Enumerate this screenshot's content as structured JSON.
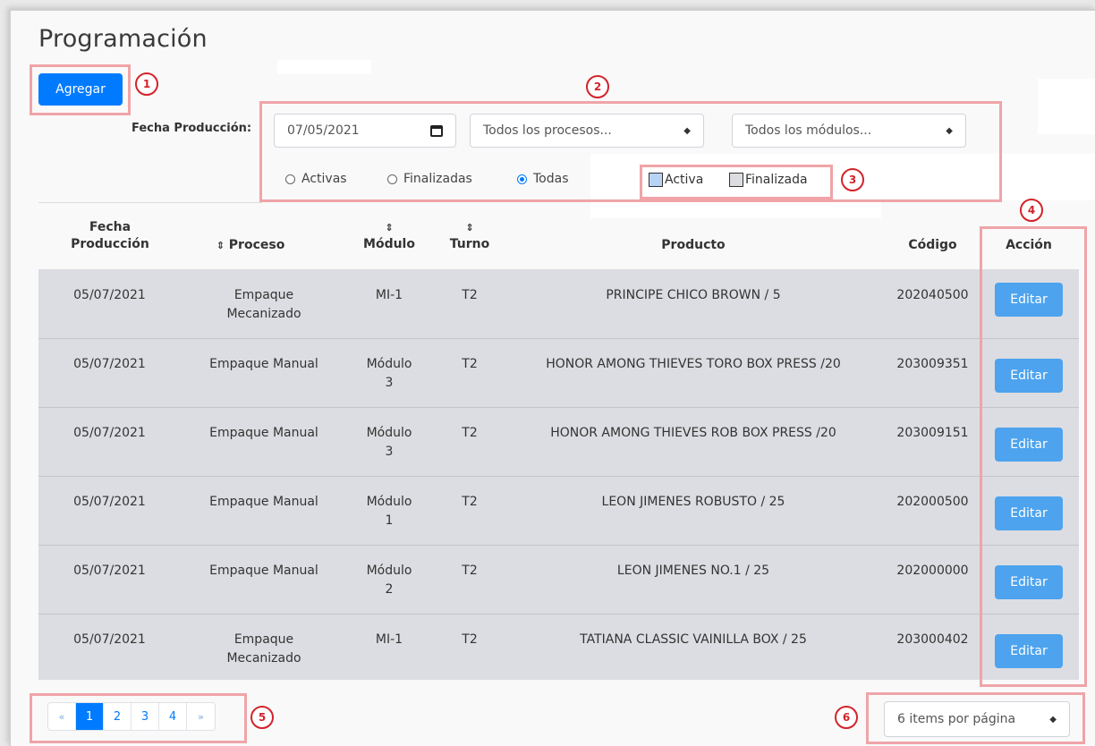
{
  "page": {
    "title": "Programación"
  },
  "toolbar": {
    "add_label": "Agregar"
  },
  "filters": {
    "label": "Fecha Producción:",
    "date_value": "07/05/2021",
    "process_selected": "Todos los procesos...",
    "module_selected": "Todos los módulos...",
    "status_options": [
      {
        "label": "Activas",
        "checked": false
      },
      {
        "label": "Finalizadas",
        "checked": false
      },
      {
        "label": "Todas",
        "checked": true
      }
    ]
  },
  "legend": [
    {
      "label": "Activa",
      "color": "#b8d4f5"
    },
    {
      "label": "Finalizada",
      "color": "#dcdde2"
    }
  ],
  "table": {
    "headers": {
      "fecha": [
        "Fecha",
        "Producción"
      ],
      "proceso": "Proceso",
      "modulo": "Módulo",
      "turno": "Turno",
      "producto": "Producto",
      "codigo": "Código",
      "accion": "Acción"
    },
    "sort_icon": "⇕",
    "edit_label": "Editar",
    "rows": [
      {
        "fecha": "05/07/2021",
        "proceso": [
          "Empaque",
          "Mecanizado"
        ],
        "modulo": [
          "MI-1"
        ],
        "turno": "T2",
        "producto": "PRINCIPE CHICO BROWN / 5",
        "codigo": "202040500"
      },
      {
        "fecha": "05/07/2021",
        "proceso": [
          "Empaque Manual"
        ],
        "modulo": [
          "Módulo",
          "3"
        ],
        "turno": "T2",
        "producto": "HONOR AMONG THIEVES TORO BOX PRESS /20",
        "codigo": "203009351"
      },
      {
        "fecha": "05/07/2021",
        "proceso": [
          "Empaque Manual"
        ],
        "modulo": [
          "Módulo",
          "3"
        ],
        "turno": "T2",
        "producto": "HONOR AMONG THIEVES ROB BOX PRESS /20",
        "codigo": "203009151"
      },
      {
        "fecha": "05/07/2021",
        "proceso": [
          "Empaque Manual"
        ],
        "modulo": [
          "Módulo",
          "1"
        ],
        "turno": "T2",
        "producto": "LEON JIMENES ROBUSTO / 25",
        "codigo": "202000500"
      },
      {
        "fecha": "05/07/2021",
        "proceso": [
          "Empaque Manual"
        ],
        "modulo": [
          "Módulo",
          "2"
        ],
        "turno": "T2",
        "producto": "LEON JIMENES NO.1 / 25",
        "codigo": "202000000"
      },
      {
        "fecha": "05/07/2021",
        "proceso": [
          "Empaque",
          "Mecanizado"
        ],
        "modulo": [
          "MI-1"
        ],
        "turno": "T2",
        "producto": "TATIANA CLASSIC VAINILLA BOX / 25",
        "codigo": "203000402"
      }
    ]
  },
  "pagination": {
    "prev": "«",
    "next": "»",
    "pages": [
      "1",
      "2",
      "3",
      "4"
    ],
    "active": "1",
    "page_size_selected": "6 items por página"
  },
  "annotations": [
    "1",
    "2",
    "3",
    "4",
    "5",
    "6"
  ],
  "colors": {
    "primary": "#007bff",
    "edit": "#4da3ee",
    "annotation": "#d3232a",
    "annotation_box": "#f0a4a8"
  }
}
